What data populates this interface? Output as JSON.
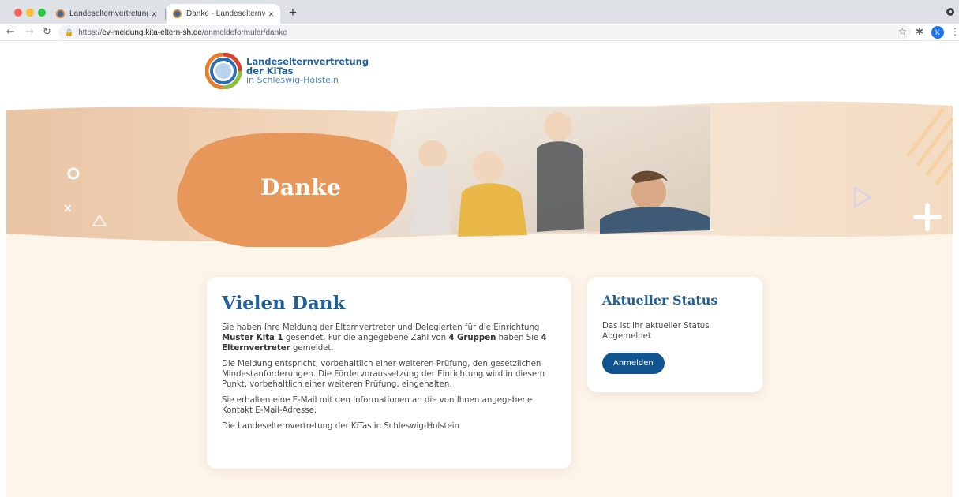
{
  "browser": {
    "tabs": [
      {
        "title": "Landeselternvertretung der KiTas"
      },
      {
        "title": "Danke - Landeselternvertretung"
      }
    ],
    "url": {
      "scheme": "https://",
      "host": "ev-meldung.kita-eltern-sh.de",
      "path": "/anmeldeformular/danke"
    },
    "profile_initial": "K"
  },
  "logo": {
    "line1": "Landeselternvertretung",
    "line2": "der KiTas",
    "line3": "in Schleswig-Holstein"
  },
  "hero": {
    "title": "Danke"
  },
  "main_card": {
    "title": "Vielen Dank",
    "p1": {
      "t1": "Sie haben Ihre Meldung der Elternvertreter und Delegierten für die Einrichtung ",
      "facility": "Muster Kita 1",
      "t2": " gesendet. Für die angegebene Zahl von ",
      "groups": "4 Gruppen",
      "t3": " haben Sie ",
      "reps": "4 Elternvertreter",
      "t4": " gemeldet."
    },
    "p2": "Die Meldung entspricht, vorbehaltlich einer weiteren Prüfung, den gesetzlichen Mindestanforderungen. Die Fördervoraussetzung der Einrichtung wird in diesem Punkt, vorbehaltlich einer weiteren Prüfung, eingehalten.",
    "p3": "Sie erhalten eine E-Mail mit den Informationen an die von Ihnen angegebene Kontakt E-Mail-Adresse.",
    "p4": "Die Landeselternvertretung der KiTas in Schleswig-Holstein"
  },
  "status_card": {
    "title": "Aktueller Status",
    "label": "Das ist Ihr aktueller Status",
    "value": "Abgemeldet",
    "button": "Anmelden"
  },
  "colors": {
    "brand_blue": "#1f5f9a",
    "button_blue": "#10558f",
    "hero_orange": "#e8975a",
    "hero_banner_bg": "#efcfb0",
    "content_bg": "#fdf4ea"
  }
}
